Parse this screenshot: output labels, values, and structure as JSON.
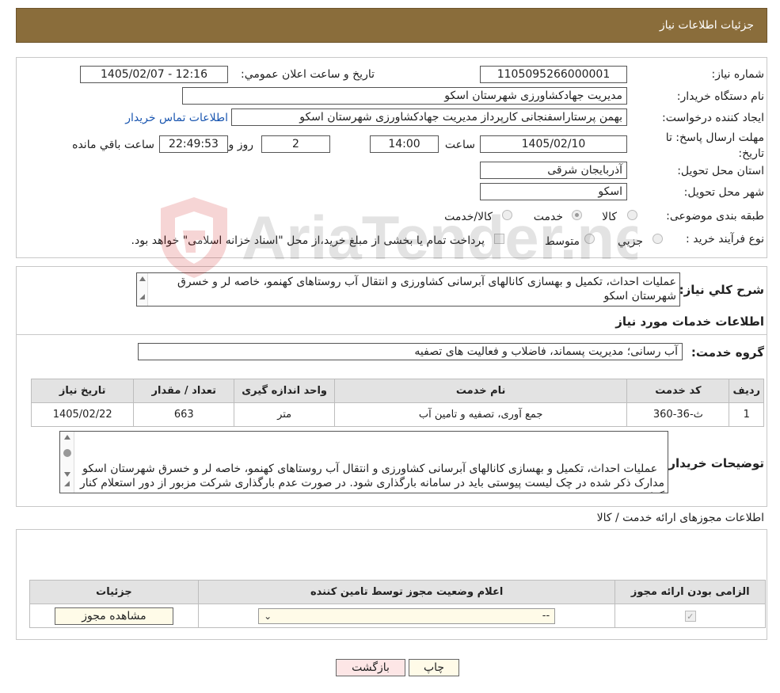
{
  "header": {
    "title": "جزئیات اطلاعات نیاز"
  },
  "fields": {
    "need_number_label": "شماره نیاز:",
    "need_number": "1105095266000001",
    "announce_label": "تاریخ و ساعت اعلان عمومي:",
    "announce_value": "1405/02/07 - 12:16",
    "buyer_org_label": "نام دستگاه خريدار:",
    "buyer_org": "مدیریت جهادکشاورزی شهرستان اسکو",
    "requester_label": "ايجاد كننده درخواست:",
    "requester": "بهمن پرستاراسفنجانی کارپرداز مدیریت جهادکشاورزی شهرستان اسکو",
    "contact_link": "اطلاعات تماس خريدار",
    "deadline_label": "مهلت ارسال پاسخ: تا تاريخ:",
    "deadline_date": "1405/02/10",
    "time_label": "ساعت",
    "deadline_time": "14:00",
    "days_value": "2",
    "days_label": "روز و",
    "remaining_time": "22:49:53",
    "remaining_label": "ساعت باقي مانده",
    "province_label": "استان محل تحويل:",
    "province": "آذربایجان شرقی",
    "city_label": "شهر محل تحويل:",
    "city": "اسکو",
    "category_label": "طبقه بندی موضوعی:",
    "category_options": [
      "کالا",
      "خدمت",
      "کالا/خدمت"
    ],
    "process_label": "نوع فرآيند خريد :",
    "process_options": [
      "جزيي",
      "متوسط"
    ],
    "payment_note": "پرداخت تمام یا بخشی از مبلغ خرید،از محل \"اسناد خزانه اسلامی\" خواهد بود."
  },
  "summary": {
    "label": "شرح كلي نياز:",
    "text": "عملیات احداث، تکمیل و بهسازی کانالهای آبرسانی کشاورزی و انتقال آب روستاهای کهنمو، خاصه لر و خسرق شهرستان اسکو"
  },
  "services": {
    "section_title": "اطلاعات خدمات مورد نياز",
    "group_label": "گروه خدمت:",
    "group_value": "آب رسانی؛ مدیریت پسماند، فاضلاب و فعالیت های تصفیه",
    "columns": [
      "رديف",
      "كد خدمت",
      "نام خدمت",
      "واحد اندازه گيری",
      "تعداد / مقدار",
      "تاريخ نياز"
    ],
    "rows": [
      [
        "1",
        "ث-36-360",
        "جمع آوری، تصفیه و تامین آب",
        "متر",
        "663",
        "1405/02/22"
      ]
    ]
  },
  "buyer_notes": {
    "label": "توضيحات خريدار:",
    "text": "عملیات احداث، تکمیل و بهسازی کانالهای آبرسانی کشاورزی و انتقال آب روستاهای کهنمو، خاصه لر و خسرق شهرستان اسکو\nمدارک ذکر شده در چک لیست پیوستی باید در سامانه بارگذاری شود. در صورت عدم بارگذاری شرکت مزبور از دور استعلام کنار گذاشته می شود."
  },
  "permits": {
    "section_title": "اطلاعات مجوزهای ارائه خدمت / کالا",
    "columns": [
      "الزامی بودن ارائه مجوز",
      "اعلام وضعیت مجوز توسط تامین کننده",
      "جزئیات"
    ],
    "select_value": "--",
    "view_button": "مشاهده مجوز"
  },
  "buttons": {
    "print": "چاپ",
    "back": "بازگشت"
  },
  "watermark": {
    "text": "AriaTender.neT"
  }
}
